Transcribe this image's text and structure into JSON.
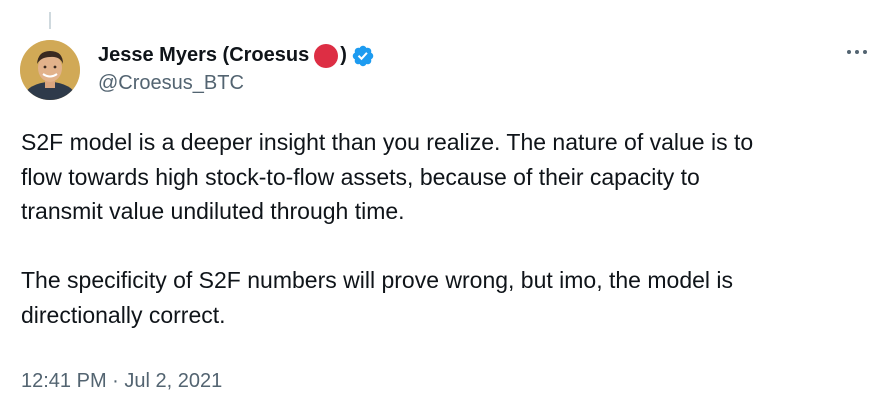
{
  "author": {
    "display_name": "Jesse Myers (Croesus",
    "name_close": ")",
    "handle": "@Croesus_BTC",
    "verified_icon": "verified-badge-icon",
    "status_emoji": "red-circle-icon"
  },
  "menu": {
    "more_icon": "more-horizontal-icon"
  },
  "tweet": {
    "paragraphs": [
      "S2F model is a deeper insight than you realize. The nature of value is to\nflow towards high stock-to-flow assets, because of their capacity to\ntransmit value undiluted through time.",
      "The specificity of S2F numbers will prove wrong, but imo, the model is\ndirectionally correct."
    ],
    "timestamp": "12:41 PM · Jul 2, 2021"
  },
  "colors": {
    "text_primary": "#0f1419",
    "text_secondary": "#536471",
    "verified_blue": "#1d9bf0",
    "red_circle": "#dd2e44",
    "thread_line": "#cfd9de"
  }
}
